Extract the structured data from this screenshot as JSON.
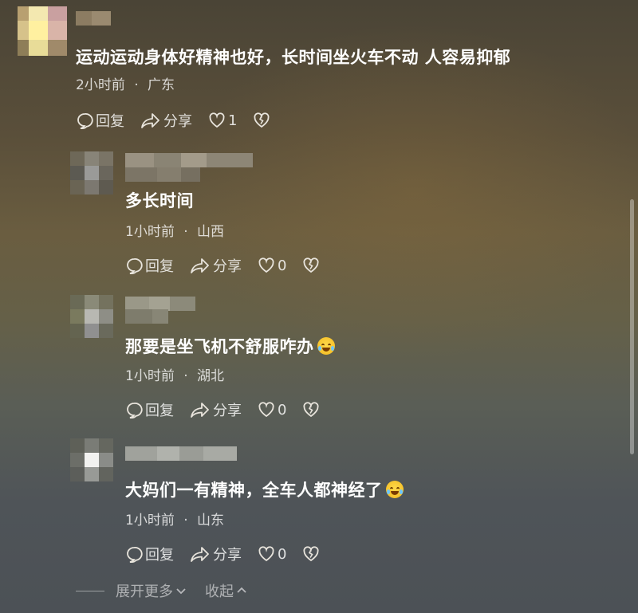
{
  "comment_top": {
    "text": "运动运动身体好精神也好，长时间坐火车不动 人容易抑郁",
    "time": "2小时前",
    "location": "广东",
    "reply_label": "回复",
    "share_label": "分享",
    "like_count": "1"
  },
  "replies": [
    {
      "text": "多长时间",
      "time": "1小时前",
      "location": "山西",
      "reply_label": "回复",
      "share_label": "分享",
      "like_count": "0"
    },
    {
      "text": "那要是坐飞机不舒服咋办",
      "time": "1小时前",
      "location": "湖北",
      "reply_label": "回复",
      "share_label": "分享",
      "like_count": "0",
      "emoji": "crying-laughing-emoji"
    },
    {
      "text": "大妈们一有精神，全车人都神经了",
      "time": "1小时前",
      "location": "山东",
      "reply_label": "回复",
      "share_label": "分享",
      "like_count": "0",
      "emoji": "laughing-tears-emoji"
    }
  ],
  "meta_separator": "·",
  "footer": {
    "expand_label": "展开更多",
    "collapse_label": "收起"
  },
  "colors": {
    "text": "#ffffff",
    "meta": "#d8d4cc",
    "emoji": "#f2b91e"
  }
}
